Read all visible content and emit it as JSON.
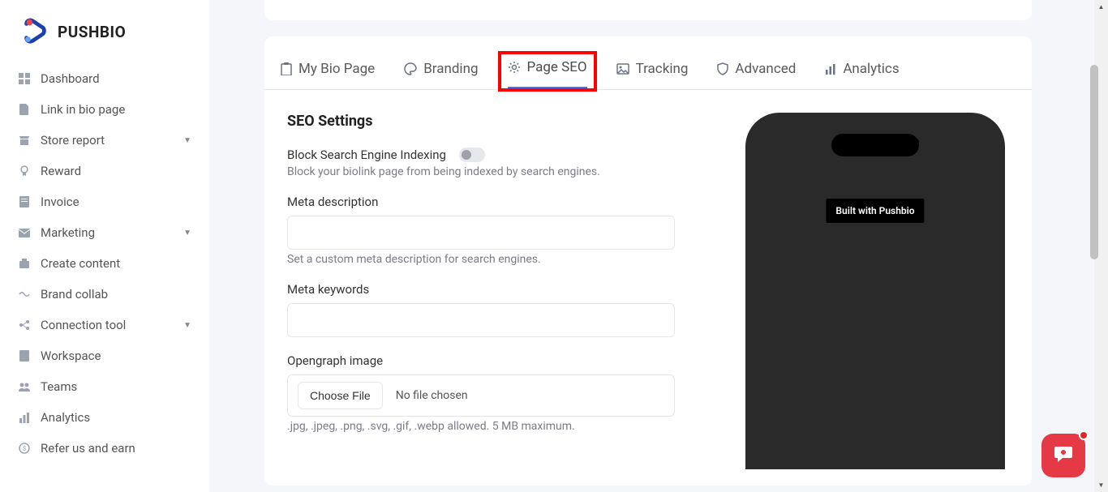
{
  "brand": {
    "name": "PUSHBIO"
  },
  "sidebar": {
    "items": [
      {
        "label": "Dashboard",
        "icon": "dashboard",
        "expandable": false
      },
      {
        "label": "Link in bio page",
        "icon": "file",
        "expandable": false
      },
      {
        "label": "Store report",
        "icon": "store",
        "expandable": true
      },
      {
        "label": "Reward",
        "icon": "reward",
        "expandable": false
      },
      {
        "label": "Invoice",
        "icon": "invoice",
        "expandable": false
      },
      {
        "label": "Marketing",
        "icon": "mail",
        "expandable": true
      },
      {
        "label": "Create content",
        "icon": "create",
        "expandable": false
      },
      {
        "label": "Brand collab",
        "icon": "collab",
        "expandable": false
      },
      {
        "label": "Connection tool",
        "icon": "connection",
        "expandable": true
      },
      {
        "label": "Workspace",
        "icon": "workspace",
        "expandable": false
      },
      {
        "label": "Teams",
        "icon": "teams",
        "expandable": false
      },
      {
        "label": "Analytics",
        "icon": "analytics",
        "expandable": false
      },
      {
        "label": "Refer us and earn",
        "icon": "refer",
        "expandable": false
      }
    ]
  },
  "tabs": [
    {
      "label": "My Bio Page",
      "icon": "clipboard"
    },
    {
      "label": "Branding",
      "icon": "palette"
    },
    {
      "label": "Page SEO",
      "icon": "gear",
      "active": true
    },
    {
      "label": "Tracking",
      "icon": "image"
    },
    {
      "label": "Advanced",
      "icon": "shield"
    },
    {
      "label": "Analytics",
      "icon": "bars"
    }
  ],
  "seo": {
    "section_title": "SEO Settings",
    "block_indexing": {
      "label": "Block Search Engine Indexing",
      "helper": "Block your biolink page from being indexed by search engines.",
      "value": false
    },
    "meta_description": {
      "label": "Meta description",
      "value": "",
      "helper": "Set a custom meta description for search engines."
    },
    "meta_keywords": {
      "label": "Meta keywords",
      "value": ""
    },
    "opengraph": {
      "label": "Opengraph image",
      "choose_button": "Choose File",
      "status": "No file chosen",
      "helper": ".jpg, .jpeg, .png, .svg, .gif, .webp allowed. 5 MB maximum."
    }
  },
  "preview": {
    "badge": "Built with Pushbio"
  }
}
